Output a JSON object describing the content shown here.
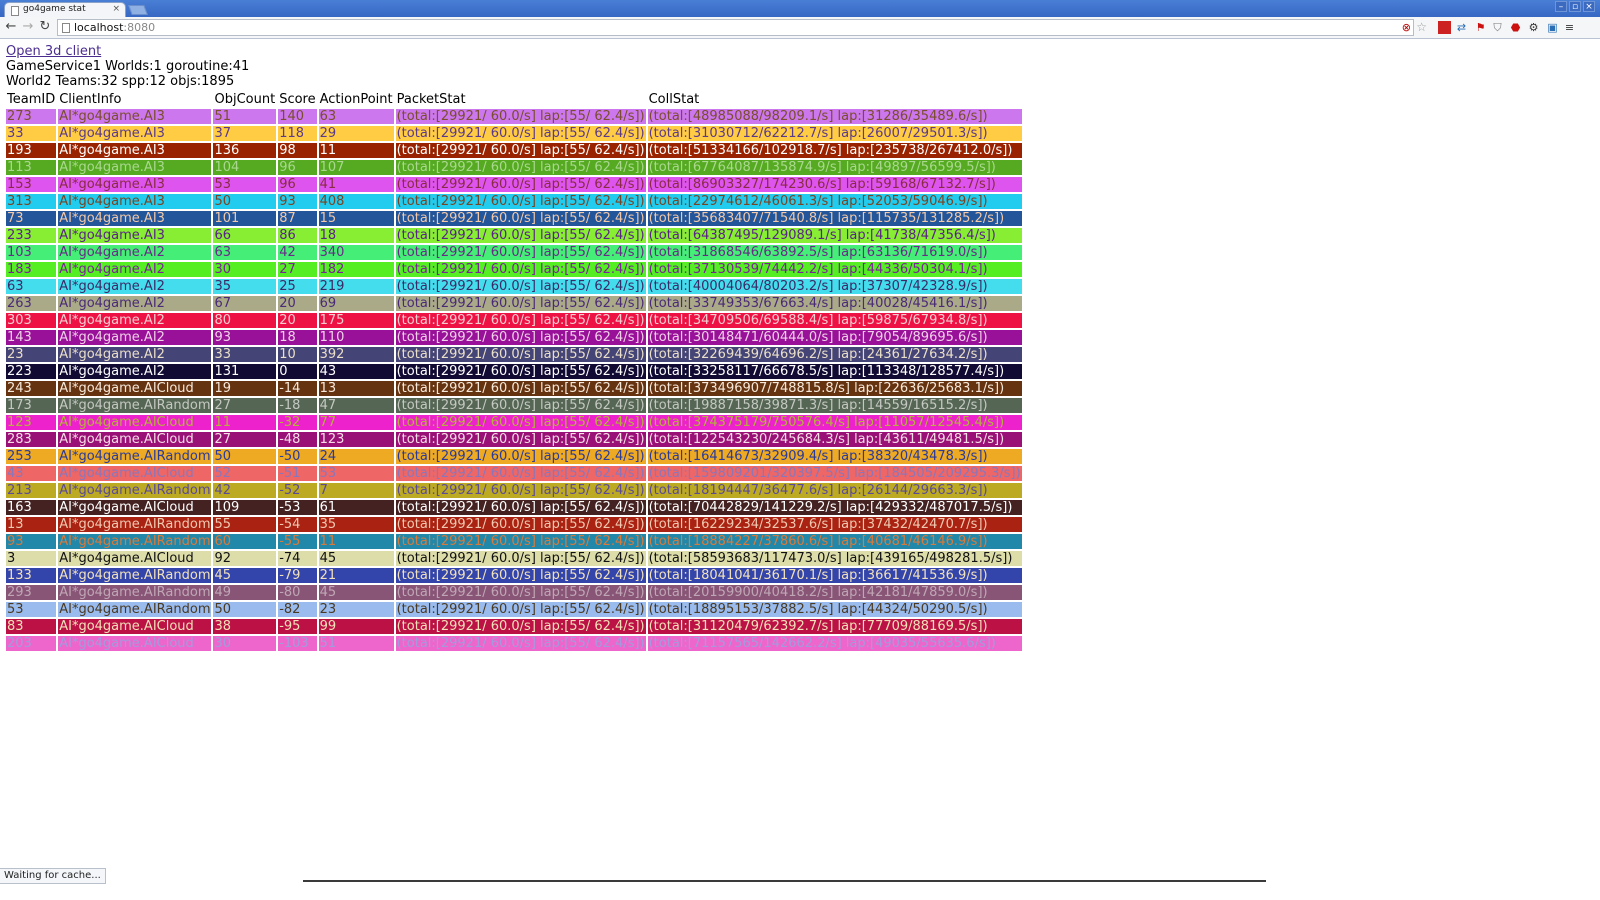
{
  "browser": {
    "tab_title": "go4game stat",
    "tab_close": "×",
    "url_host": "localhost",
    "url_port": ":8080",
    "window_controls": [
      "–",
      "▫",
      "×"
    ]
  },
  "page": {
    "link_text": "Open 3d client",
    "service_line": "GameService1 Worlds:1 goroutine:41",
    "world_line": "World2 Teams:32 spp:12 objs:1895",
    "columns": [
      "TeamID",
      "ClientInfo",
      "ObjCount",
      "Score",
      "ActionPoint",
      "PacketStat",
      "CollStat"
    ],
    "rows": [
      {
        "team_id": "273",
        "client": "AI*go4game.AI3",
        "obj": "51",
        "score": "140",
        "ap": "63",
        "packet": "(total:[29921/ 60.0/s] lap:[55/ 62.4/s])",
        "coll": "(total:[48985088/98209.1/s] lap:[31286/35489.6/s])",
        "bg": "#cc77ee",
        "fg": "#7a4d2e"
      },
      {
        "team_id": "33",
        "client": "AI*go4game.AI3",
        "obj": "37",
        "score": "118",
        "ap": "29",
        "packet": "(total:[29921/ 60.0/s] lap:[55/ 62.4/s])",
        "coll": "(total:[31030712/62212.7/s] lap:[26007/29501.3/s])",
        "bg": "#ffcc44",
        "fg": "#5a3a8a"
      },
      {
        "team_id": "193",
        "client": "AI*go4game.AI3",
        "obj": "136",
        "score": "98",
        "ap": "11",
        "packet": "(total:[29921/ 60.0/s] lap:[55/ 62.4/s])",
        "coll": "(total:[51334166/102918.7/s] lap:[235738/267412.0/s])",
        "bg": "#992200",
        "fg": "#ffffff"
      },
      {
        "team_id": "113",
        "client": "AI*go4game.AI3",
        "obj": "104",
        "score": "96",
        "ap": "107",
        "packet": "(total:[29921/ 60.0/s] lap:[55/ 62.4/s])",
        "coll": "(total:[67764087/135874.9/s] lap:[49897/56599.5/s])",
        "bg": "#55aa22",
        "fg": "#a9d88e"
      },
      {
        "team_id": "153",
        "client": "AI*go4game.AI3",
        "obj": "53",
        "score": "96",
        "ap": "41",
        "packet": "(total:[29921/ 60.0/s] lap:[55/ 62.4/s])",
        "coll": "(total:[86903327/174230.6/s] lap:[59168/67132.7/s])",
        "bg": "#dd55ee",
        "fg": "#8a2a44"
      },
      {
        "team_id": "313",
        "client": "AI*go4game.AI3",
        "obj": "50",
        "score": "93",
        "ap": "408",
        "packet": "(total:[29921/ 60.0/s] lap:[55/ 62.4/s])",
        "coll": "(total:[22974612/46061.3/s] lap:[52053/59046.9/s])",
        "bg": "#22ccee",
        "fg": "#7a4422"
      },
      {
        "team_id": "73",
        "client": "AI*go4game.AI3",
        "obj": "101",
        "score": "87",
        "ap": "15",
        "packet": "(total:[29921/ 60.0/s] lap:[55/ 62.4/s])",
        "coll": "(total:[35683407/71540.8/s] lap:[115735/131285.2/s])",
        "bg": "#225599",
        "fg": "#f2c8a8"
      },
      {
        "team_id": "233",
        "client": "AI*go4game.AI3",
        "obj": "66",
        "score": "86",
        "ap": "18",
        "packet": "(total:[29921/ 60.0/s] lap:[55/ 62.4/s])",
        "coll": "(total:[64387495/129089.1/s] lap:[41738/47356.4/s])",
        "bg": "#88ee33",
        "fg": "#5a2288"
      },
      {
        "team_id": "103",
        "client": "AI*go4game.AI2",
        "obj": "63",
        "score": "42",
        "ap": "340",
        "packet": "(total:[29921/ 60.0/s] lap:[55/ 62.4/s])",
        "coll": "(total:[31868546/63892.5/s] lap:[63136/71619.0/s])",
        "bg": "#44ee77",
        "fg": "#6a2a88"
      },
      {
        "team_id": "183",
        "client": "AI*go4game.AI2",
        "obj": "30",
        "score": "27",
        "ap": "182",
        "packet": "(total:[29921/ 60.0/s] lap:[55/ 62.4/s])",
        "coll": "(total:[37130539/74442.2/s] lap:[44336/50304.1/s])",
        "bg": "#55ee22",
        "fg": "#7a2299"
      },
      {
        "team_id": "63",
        "client": "AI*go4game.AI2",
        "obj": "35",
        "score": "25",
        "ap": "219",
        "packet": "(total:[29921/ 60.0/s] lap:[55/ 62.4/s])",
        "coll": "(total:[40004064/80203.2/s] lap:[37307/42328.9/s])",
        "bg": "#44ddee",
        "fg": "#3a2a66"
      },
      {
        "team_id": "263",
        "client": "AI*go4game.AI2",
        "obj": "67",
        "score": "20",
        "ap": "69",
        "packet": "(total:[29921/ 60.0/s] lap:[55/ 62.4/s])",
        "coll": "(total:[33749353/67663.4/s] lap:[40028/45416.1/s])",
        "bg": "#aaaa88",
        "fg": "#4a2a77"
      },
      {
        "team_id": "303",
        "client": "AI*go4game.AI2",
        "obj": "80",
        "score": "20",
        "ap": "175",
        "packet": "(total:[29921/ 60.0/s] lap:[55/ 62.4/s])",
        "coll": "(total:[34709506/69588.4/s] lap:[59875/67934.8/s])",
        "bg": "#ee1144",
        "fg": "#f4cdd0"
      },
      {
        "team_id": "143",
        "client": "AI*go4game.AI2",
        "obj": "93",
        "score": "18",
        "ap": "110",
        "packet": "(total:[29921/ 60.0/s] lap:[55/ 62.4/s])",
        "coll": "(total:[30148471/60444.0/s] lap:[79054/89695.6/s])",
        "bg": "#991199",
        "fg": "#f0d0e8"
      },
      {
        "team_id": "23",
        "client": "AI*go4game.AI2",
        "obj": "33",
        "score": "10",
        "ap": "392",
        "packet": "(total:[29921/ 60.0/s] lap:[55/ 62.4/s])",
        "coll": "(total:[32269439/64696.2/s] lap:[24361/27634.2/s])",
        "bg": "#444477",
        "fg": "#eadfc8"
      },
      {
        "team_id": "223",
        "client": "AI*go4game.AI2",
        "obj": "131",
        "score": "0",
        "ap": "43",
        "packet": "(total:[29921/ 60.0/s] lap:[55/ 62.4/s])",
        "coll": "(total:[33258117/66678.5/s] lap:[113348/128577.4/s])",
        "bg": "#110a33",
        "fg": "#ffffff"
      },
      {
        "team_id": "243",
        "client": "AI*go4game.AICloud",
        "obj": "19",
        "score": "-14",
        "ap": "13",
        "packet": "(total:[29921/ 60.0/s] lap:[55/ 62.4/s])",
        "coll": "(total:[373496907/748815.8/s] lap:[22636/25683.1/s])",
        "bg": "#663311",
        "fg": "#f6e8d8"
      },
      {
        "team_id": "173",
        "client": "AI*go4game.AIRandom",
        "obj": "27",
        "score": "-18",
        "ap": "47",
        "packet": "(total:[29921/ 60.0/s] lap:[55/ 62.4/s])",
        "coll": "(total:[19887158/39871.3/s] lap:[14559/16515.2/s])",
        "bg": "#556655",
        "fg": "#c4c8c0"
      },
      {
        "team_id": "123",
        "client": "AI*go4game.AICloud",
        "obj": "11",
        "score": "-32",
        "ap": "77",
        "packet": "(total:[29921/ 60.0/s] lap:[55/ 62.4/s])",
        "coll": "(total:[374375179/750576.4/s] lap:[11057/12545.4/s])",
        "bg": "#ee22cc",
        "fg": "#b3b33a"
      },
      {
        "team_id": "283",
        "client": "AI*go4game.AICloud",
        "obj": "27",
        "score": "-48",
        "ap": "123",
        "packet": "(total:[29921/ 60.0/s] lap:[55/ 62.4/s])",
        "coll": "(total:[122543230/245684.3/s] lap:[43611/49481.5/s])",
        "bg": "#991177",
        "fg": "#f6dce6"
      },
      {
        "team_id": "253",
        "client": "AI*go4game.AIRandom",
        "obj": "50",
        "score": "-50",
        "ap": "24",
        "packet": "(total:[29921/ 60.0/s] lap:[55/ 62.4/s])",
        "coll": "(total:[16414673/32909.4/s] lap:[38320/43478.3/s])",
        "bg": "#eeaa22",
        "fg": "#2a3a99"
      },
      {
        "team_id": "43",
        "client": "AI*go4game.AICloud",
        "obj": "52",
        "score": "-51",
        "ap": "53",
        "packet": "(total:[29921/ 60.0/s] lap:[55/ 62.4/s])",
        "coll": "(total:[159809201/320397.5/s] lap:[184505/209295.3/s])",
        "bg": "#ee6666",
        "fg": "#8a77bb"
      },
      {
        "team_id": "213",
        "client": "AI*go4game.AIRandom",
        "obj": "42",
        "score": "-52",
        "ap": "7",
        "packet": "(total:[29921/ 60.0/s] lap:[55/ 62.4/s])",
        "coll": "(total:[18194447/36477.6/s] lap:[26144/29663.3/s])",
        "bg": "#bbaa22",
        "fg": "#5a4a99"
      },
      {
        "team_id": "163",
        "client": "AI*go4game.AICloud",
        "obj": "109",
        "score": "-53",
        "ap": "61",
        "packet": "(total:[29921/ 60.0/s] lap:[55/ 62.4/s])",
        "coll": "(total:[70442829/141229.2/s] lap:[429332/487017.5/s])",
        "bg": "#442222",
        "fg": "#ffffff"
      },
      {
        "team_id": "13",
        "client": "AI*go4game.AIRandom",
        "obj": "55",
        "score": "-54",
        "ap": "35",
        "packet": "(total:[29921/ 60.0/s] lap:[55/ 62.4/s])",
        "coll": "(total:[16229234/32537.6/s] lap:[37432/42470.7/s])",
        "bg": "#aa2211",
        "fg": "#f0c8b0"
      },
      {
        "team_id": "93",
        "client": "AI*go4game.AIRandom",
        "obj": "60",
        "score": "-55",
        "ap": "11",
        "packet": "(total:[29921/ 60.0/s] lap:[55/ 62.4/s])",
        "coll": "(total:[18884227/37860.6/s] lap:[40681/46146.9/s])",
        "bg": "#2288aa",
        "fg": "#d87a3a"
      },
      {
        "team_id": "3",
        "client": "AI*go4game.AICloud",
        "obj": "92",
        "score": "-74",
        "ap": "45",
        "packet": "(total:[29921/ 60.0/s] lap:[55/ 62.4/s])",
        "coll": "(total:[58593683/117473.0/s] lap:[439165/498281.5/s])",
        "bg": "#ddddaa",
        "fg": "#111111"
      },
      {
        "team_id": "133",
        "client": "AI*go4game.AIRandom",
        "obj": "45",
        "score": "-79",
        "ap": "21",
        "packet": "(total:[29921/ 60.0/s] lap:[55/ 62.4/s])",
        "coll": "(total:[18041041/36170.1/s] lap:[36617/41536.9/s])",
        "bg": "#3344aa",
        "fg": "#f2e2bc"
      },
      {
        "team_id": "293",
        "client": "AI*go4game.AIRandom",
        "obj": "49",
        "score": "-80",
        "ap": "45",
        "packet": "(total:[29921/ 60.0/s] lap:[55/ 62.4/s])",
        "coll": "(total:[20159900/40418.2/s] lap:[42181/47859.0/s])",
        "bg": "#885577",
        "fg": "#c0a6b4"
      },
      {
        "team_id": "53",
        "client": "AI*go4game.AIRandom",
        "obj": "50",
        "score": "-82",
        "ap": "23",
        "packet": "(total:[29921/ 60.0/s] lap:[55/ 62.4/s])",
        "coll": "(total:[18895153/37882.5/s] lap:[44324/50290.5/s])",
        "bg": "#99bbee",
        "fg": "#4a3a22"
      },
      {
        "team_id": "83",
        "client": "AI*go4game.AICloud",
        "obj": "38",
        "score": "-95",
        "ap": "99",
        "packet": "(total:[29921/ 60.0/s] lap:[55/ 62.4/s])",
        "coll": "(total:[31120479/62392.7/s] lap:[77709/88169.5/s])",
        "bg": "#bb1144",
        "fg": "#f2e0b8"
      },
      {
        "team_id": "203",
        "client": "AI*go4game.AICloud",
        "obj": "30",
        "score": "-103",
        "ap": "51",
        "packet": "(total:[29921/ 60.0/s] lap:[55/ 62.4/s])",
        "coll": "(total:[71157565/142662.2/s] lap:[49035/55635.6/s])",
        "bg": "#ee66cc",
        "fg": "#a39add"
      }
    ]
  },
  "status": {
    "text": "Waiting for cache..."
  }
}
